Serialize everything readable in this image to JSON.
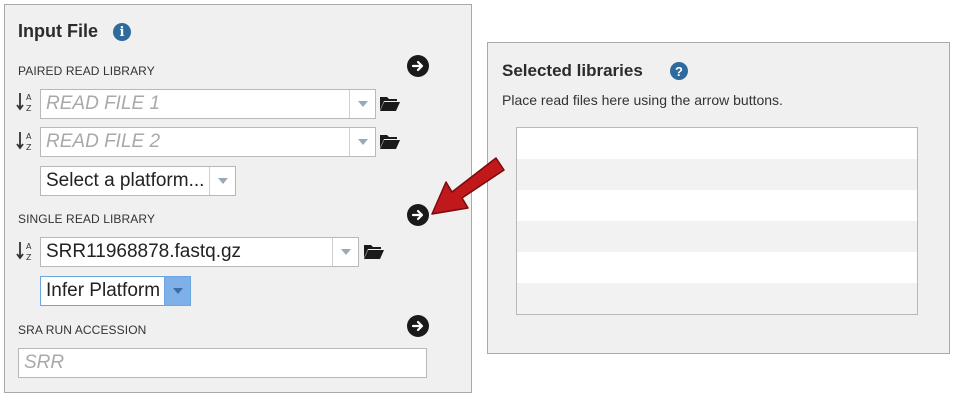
{
  "input_file": {
    "title": "Input File",
    "info_icon": "info-icon",
    "paired": {
      "label": "PAIRED READ LIBRARY",
      "read1_placeholder": "READ FILE 1",
      "read2_placeholder": "READ FILE 2",
      "platform_value": "Select a platform..."
    },
    "single": {
      "label": "SINGLE READ LIBRARY",
      "file_value": "SRR11968878.fastq.gz",
      "platform_value": "Infer Platform"
    },
    "sra": {
      "label": "SRA RUN ACCESSION",
      "placeholder": "SRR"
    }
  },
  "selected_libraries": {
    "title": "Selected libraries",
    "help_icon": "help-icon",
    "hint": "Place read files here using the arrow buttons."
  },
  "colors": {
    "accent_blue": "#2f6a9c",
    "annotation_red": "#c0181b",
    "panel_bg": "#f0f0f1"
  }
}
